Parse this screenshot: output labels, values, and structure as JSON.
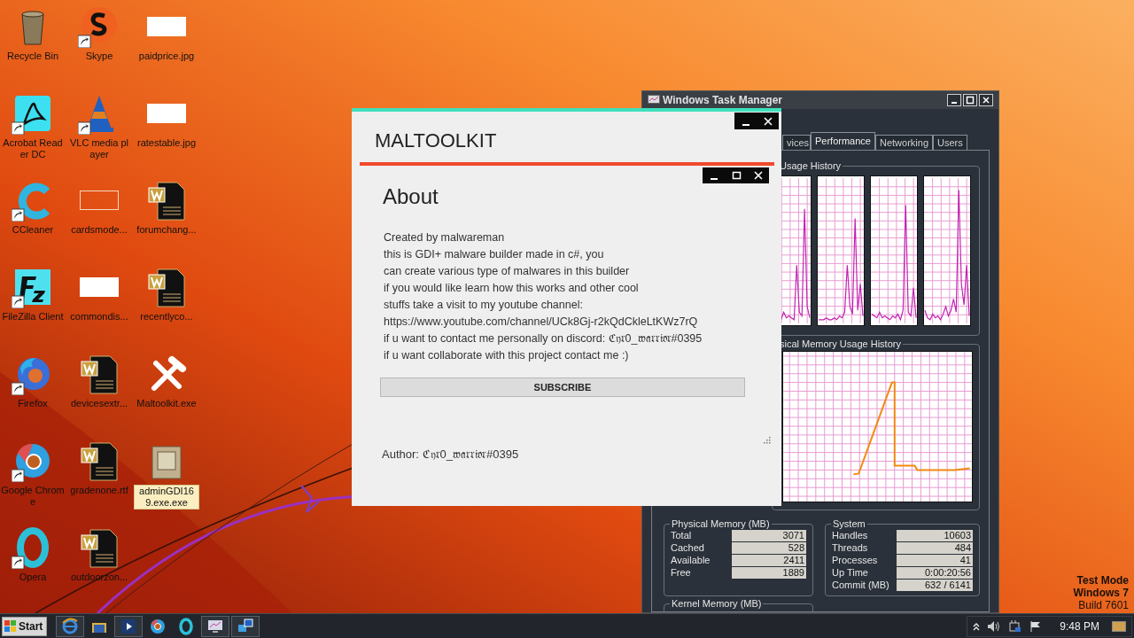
{
  "desktop": {
    "icons": [
      {
        "kind": "recycle",
        "label": "Recycle Bin",
        "shortcut": false,
        "selected": false
      },
      {
        "kind": "acrobat",
        "label": "Acrobat Reader DC",
        "shortcut": true,
        "selected": false
      },
      {
        "kind": "ccleaner",
        "label": "CCleaner",
        "shortcut": true,
        "selected": false
      },
      {
        "kind": "filezilla",
        "label": "FileZilla Client",
        "shortcut": true,
        "selected": false
      },
      {
        "kind": "firefox",
        "label": "Firefox",
        "shortcut": true,
        "selected": false
      },
      {
        "kind": "chrome",
        "label": "Google Chrome",
        "shortcut": true,
        "selected": false
      },
      {
        "kind": "opera",
        "label": "Opera",
        "shortcut": true,
        "selected": false
      },
      {
        "kind": "skype",
        "label": "Skype",
        "shortcut": true,
        "selected": false
      },
      {
        "kind": "vlc",
        "label": "VLC media player",
        "shortcut": true,
        "selected": false
      },
      {
        "kind": "blank",
        "label": "cardsmode...",
        "selected": false
      },
      {
        "label": "commondis...",
        "selected": false
      },
      {
        "kind": "doc",
        "label": "devicesextr...",
        "shortcut": false,
        "selected": false
      },
      {
        "kind": "doc",
        "label": "gradenone.rtf",
        "shortcut": false,
        "selected": false
      },
      {
        "kind": "doc",
        "label": "outdoorzon...",
        "shortcut": false,
        "selected": false
      },
      {
        "label": "paidprice.jpg",
        "selected": false
      },
      {
        "label": "ratestable.jpg",
        "selected": false
      },
      {
        "kind": "doc",
        "label": "forumchang...",
        "shortcut": false,
        "selected": false
      },
      {
        "kind": "doc",
        "label": "recentlyco...",
        "shortcut": false,
        "selected": false
      },
      {
        "kind": "tools",
        "label": "Maltoolkit.exe",
        "shortcut": false,
        "selected": false
      },
      {
        "kind": "package",
        "label": "adminGDI169.exe.exe",
        "shortcut": false,
        "selected": true
      }
    ]
  },
  "task_manager": {
    "title": "Windows Task Manager",
    "tabs": [
      {
        "label": "vices",
        "selected": false
      },
      {
        "label": "Performance",
        "selected": true
      },
      {
        "label": "Networking",
        "selected": false
      },
      {
        "label": "Users",
        "selected": false
      }
    ],
    "cpu_history": {
      "title": "Usage History"
    },
    "memory_history": {
      "title": "sical Memory Usage History"
    },
    "physical_memory": {
      "title": "Physical Memory (MB)",
      "rows": [
        {
          "label": "Total",
          "value": "3071"
        },
        {
          "label": "Cached",
          "value": "528"
        },
        {
          "label": "Available",
          "value": "2411"
        },
        {
          "label": "Free",
          "value": "1889"
        }
      ]
    },
    "system": {
      "title": "System",
      "rows": [
        {
          "label": "Handles",
          "value": "10603"
        },
        {
          "label": "Threads",
          "value": "484"
        },
        {
          "label": "Processes",
          "value": "41"
        },
        {
          "label": "Up Time",
          "value": "0:00:20:56"
        },
        {
          "label": "Commit (MB)",
          "value": "632 / 6141"
        }
      ]
    },
    "kernel_memory": {
      "title": "Kernel Memory (MB)"
    }
  },
  "app_window": {
    "title": "MALTOOLKIT",
    "page_title": "About",
    "lines": [
      "Created by malwareman",
      "this is GDI+ malware builder made in c#, you",
      "can create various type of malwares in this builder",
      "if you would like learn how this works and other cool",
      "stuffs take a visit to my youtube channel:",
      "https://www.youtube.com/channel/UCk8Gj-r2kQdCkleLtKWz7rQ",
      "if u want to contact me personally on discord: ℭ𝔶𝔯0_𝔴𝔞𝔯𝔯𝔦𝔬𝔯#0395",
      "if u want collaborate with this project contact me :)"
    ],
    "button": "SUBSCRIBE",
    "author": "Author: ℭ𝔶𝔯0_𝔴𝔞𝔯𝔯𝔦𝔬𝔯#0395"
  },
  "os_notice": [
    "Test Mode",
    "Windows 7",
    "Build 7601"
  ],
  "taskbar": {
    "start": "Start",
    "apps": [
      {
        "kind": "ie",
        "open": true
      },
      {
        "kind": "explorer",
        "open": false
      },
      {
        "kind": "media",
        "open": true
      },
      {
        "kind": "chrome",
        "open": false
      },
      {
        "kind": "opera",
        "open": false
      },
      {
        "kind": "taskmgr",
        "open": true
      },
      {
        "kind": "remote",
        "open": true
      }
    ],
    "clock": "9:48 PM"
  }
}
